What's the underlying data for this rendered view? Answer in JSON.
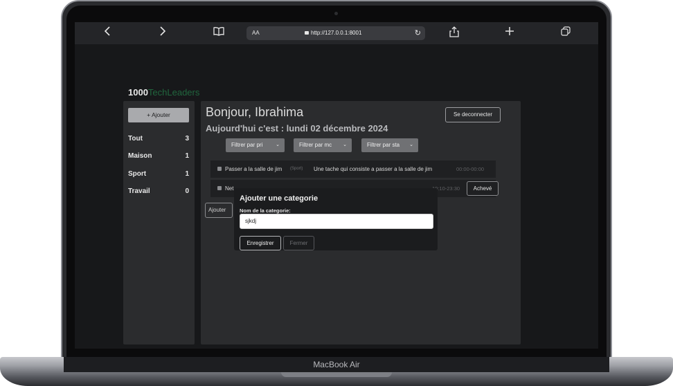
{
  "device": {
    "brand_label": "MacBook Air"
  },
  "browser": {
    "url": "http://127.0.0.1:8001",
    "text_size_label": "AA",
    "icons": [
      "back-icon",
      "forward-icon",
      "bookmarks-icon",
      "lock-icon",
      "reload-icon",
      "share-icon",
      "new-tab-icon",
      "tabs-icon"
    ]
  },
  "app": {
    "brand_primary": "1000",
    "brand_accent": "TechLeaders",
    "accent_color": "#21663e"
  },
  "sidebar": {
    "add_label": "+ Ajouter",
    "categories": [
      {
        "name": "Tout",
        "count": "3"
      },
      {
        "name": "Maison",
        "count": "1"
      },
      {
        "name": "Sport",
        "count": "1"
      },
      {
        "name": "Travail",
        "count": "0"
      }
    ]
  },
  "main": {
    "greeting": "Bonjour, Ibrahima",
    "today": "Aujourd'hui c'est : lundi 02 décembre 2024",
    "logout_label": "Se deconnecter",
    "filters": [
      {
        "label": "Filtrer par pri"
      },
      {
        "label": "Filtrer par mc"
      },
      {
        "label": "Filtrer par sta"
      }
    ],
    "tasks": [
      {
        "title": "Passer a la salle de jim",
        "category": "(Sport)",
        "description": "Une tache qui consiste a passer a la salle de jim",
        "time": "00:00-00:00",
        "action": ""
      },
      {
        "title": "Net",
        "category": "",
        "description": "",
        "time": "10:10-23:30",
        "action": "Achevé"
      }
    ],
    "add_task_label": "Ajouter"
  },
  "modal": {
    "title": "Ajouter une categorie",
    "field_label": "Nom de la categorie:",
    "field_value": "sjkdj",
    "save_label": "Enregistrer",
    "close_label": "Fermer"
  }
}
